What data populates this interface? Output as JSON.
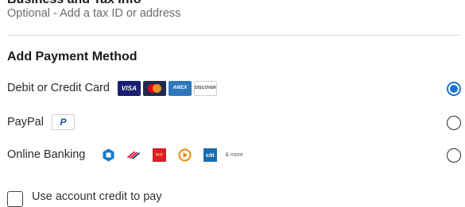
{
  "business_section": {
    "title": "Business and Tax Info",
    "optional_text": "Optional - Add a tax ID or address"
  },
  "payment_method": {
    "title": "Add Payment Method",
    "options": [
      {
        "label": "Debit or Credit Card",
        "selected": true,
        "logos": [
          "visa",
          "mastercard",
          "amex",
          "discover"
        ]
      },
      {
        "label": "PayPal",
        "selected": false,
        "logos": [
          "paypal"
        ]
      },
      {
        "label": "Online Banking",
        "selected": false,
        "logos": [
          "chase",
          "bank-of-america",
          "wells-fargo",
          "usaa",
          "citi"
        ],
        "more_text": "& more"
      }
    ]
  },
  "card_logos": {
    "visa": "VISA",
    "amex": "AMEX",
    "discover": "DISCOVER",
    "paypal": "P",
    "wells_fargo": "WF",
    "citi": "citi"
  },
  "credit_checkbox": {
    "label": "Use account credit to pay",
    "checked": false
  },
  "colors": {
    "accent": "#1a73d9",
    "visa": "#1a1f71",
    "amex": "#2e77bc",
    "chase": "#117aca",
    "bank_of_america": "#d4001a",
    "wells_fargo": "#d71e28",
    "usaa": "#f08a00",
    "citi": "#1c6aa8"
  }
}
